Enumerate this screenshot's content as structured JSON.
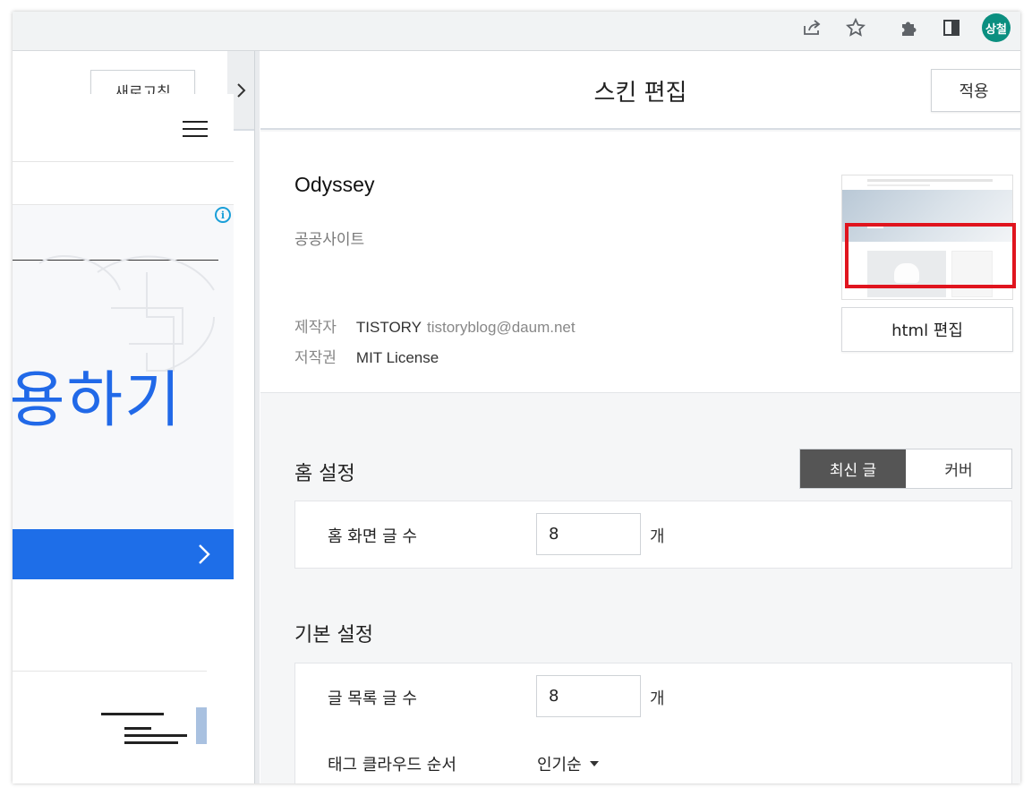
{
  "browser": {
    "avatar_text": "상철",
    "icons": [
      "share-icon",
      "star-icon",
      "puzzle-icon",
      "sidepanel-icon"
    ]
  },
  "preview_pane": {
    "refresh_label": "새로고침",
    "ad_text": "용하기"
  },
  "editor": {
    "title": "스킨 편집",
    "apply_label": "적용",
    "skin": {
      "name": "Odyssey",
      "category": "공공사이트",
      "author_label": "제작자",
      "author": "TISTORY",
      "author_email": "tistoryblog@daum.net",
      "license_label": "저작권",
      "license": "MIT License",
      "html_edit_label": "html 편집"
    },
    "home_settings": {
      "title": "홈 설정",
      "toggle": [
        {
          "label": "최신 글",
          "selected": true
        },
        {
          "label": "커버",
          "selected": false
        }
      ],
      "post_count_label": "홈 화면 글 수",
      "post_count_value": "8",
      "unit": "개"
    },
    "basic_settings": {
      "title": "기본 설정",
      "list_count_label": "글 목록 글 수",
      "list_count_value": "8",
      "unit": "개",
      "tag_cloud_label": "태그 클라우드 순서",
      "tag_cloud_value": "인기순"
    }
  },
  "colors": {
    "highlight_red": "#e0141e",
    "preview_blue": "#1e6ee8",
    "toggle_selected": "#555555",
    "avatar": "#0b8f80"
  }
}
